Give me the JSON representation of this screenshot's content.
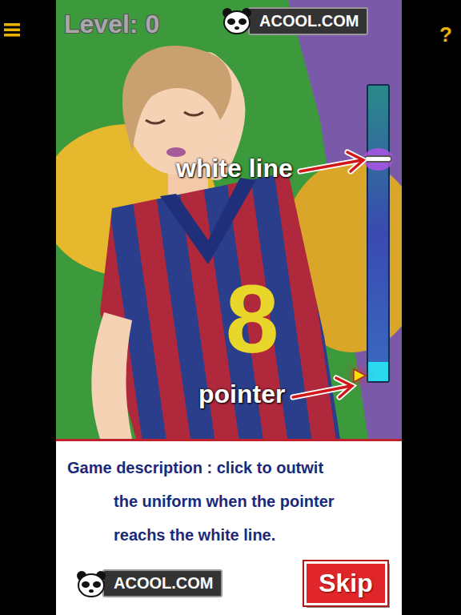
{
  "help_label": "?",
  "level_label": "Level: 0",
  "logo": {
    "text": "ACOOL.COM"
  },
  "jersey_number": "8",
  "meter": {
    "target_level": 0.75,
    "pointer_level": 0.02
  },
  "annotations": [
    {
      "label": "white line"
    },
    {
      "label": "pointer"
    }
  ],
  "description": {
    "lines": [
      "Game description :  click to outwit",
      "the uniform when the pointer",
      "reachs the white line."
    ]
  },
  "footer_logo": {
    "text": "ACOOL.COM"
  },
  "skip_button": {
    "label": "Skip"
  }
}
